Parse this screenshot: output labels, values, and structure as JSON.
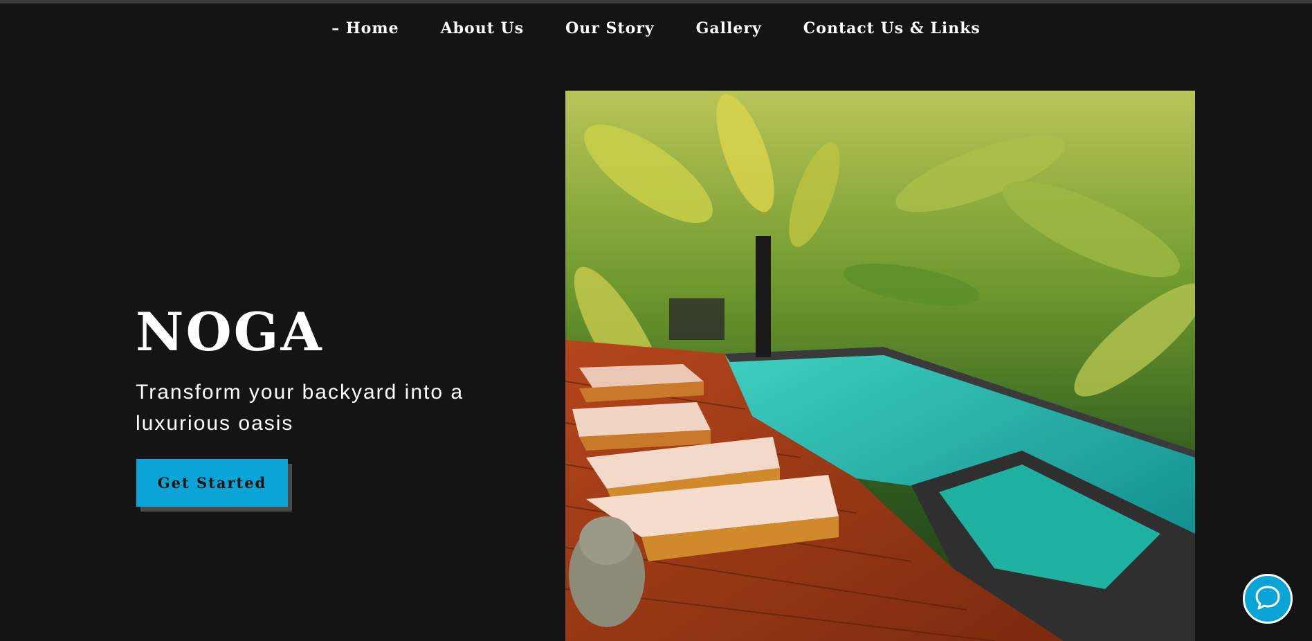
{
  "nav": {
    "items": [
      {
        "label": "– Home",
        "active": true
      },
      {
        "label": "About Us"
      },
      {
        "label": "Our Story"
      },
      {
        "label": "Gallery"
      },
      {
        "label": "Contact Us & Links"
      }
    ]
  },
  "hero": {
    "title": "NOGA",
    "subtitle": "Transform your backyard into a luxurious oasis",
    "cta_label": "Get Started"
  },
  "chat": {
    "icon": "chat-bubble-icon"
  },
  "colors": {
    "background": "#141414",
    "accent": "#0aa5d6",
    "text": "#ffffff"
  }
}
